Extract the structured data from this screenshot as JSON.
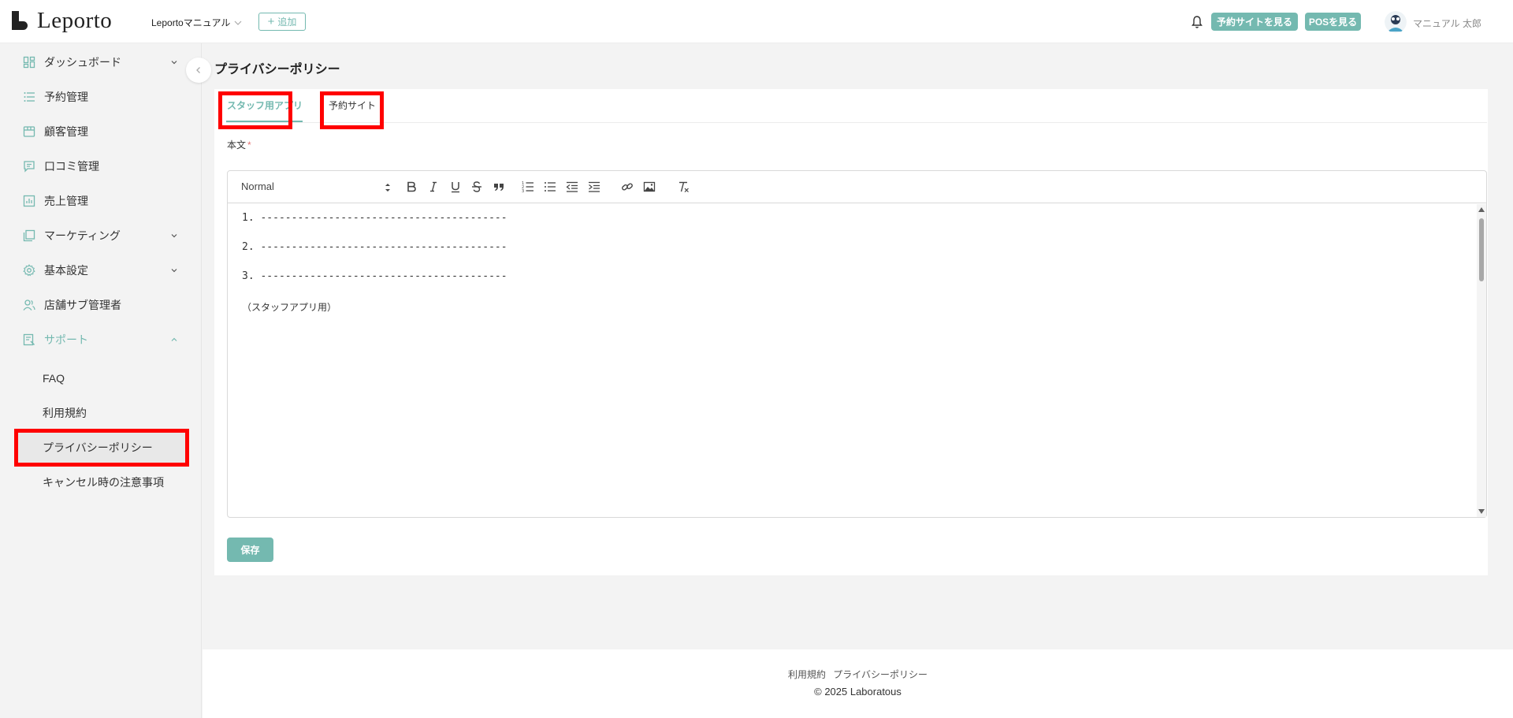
{
  "brand": {
    "name": "Leporto"
  },
  "header": {
    "store_name": "Leportoマニュアル",
    "add_label": "追加",
    "view_site_label": "予約サイトを見る",
    "view_pos_label": "POSを見る",
    "user_name": "マニュアル 太郎",
    "icons": [
      "bell-icon",
      "avatar"
    ]
  },
  "sidebar": {
    "items": [
      {
        "label": "ダッシュボード",
        "icon": "dashboard-icon",
        "expandable": true
      },
      {
        "label": "予約管理",
        "icon": "list-icon"
      },
      {
        "label": "顧客管理",
        "icon": "customer-card-icon"
      },
      {
        "label": "口コミ管理",
        "icon": "review-icon"
      },
      {
        "label": "売上管理",
        "icon": "sales-chart-icon"
      },
      {
        "label": "マーケティング",
        "icon": "marketing-icon",
        "expandable": true
      },
      {
        "label": "基本設定",
        "icon": "gear-icon",
        "expandable": true
      },
      {
        "label": "店舗サブ管理者",
        "icon": "users-icon"
      },
      {
        "label": "サポート",
        "icon": "support-icon",
        "expandable": true,
        "expanded": true,
        "active": true
      }
    ],
    "sub_items": [
      {
        "label": "FAQ"
      },
      {
        "label": "利用規約"
      },
      {
        "label": "プライバシーポリシー",
        "selected": true
      },
      {
        "label": "キャンセル時の注意事項"
      }
    ]
  },
  "main": {
    "title": "プライバシーポリシー",
    "tabs": [
      {
        "label": "スタッフ用アプリ",
        "active": true
      },
      {
        "label": "予約サイト",
        "active": false
      }
    ],
    "field_label": "本文",
    "required_mark": "*",
    "editor": {
      "format_select": "Normal",
      "toolbar_buttons": [
        "bold",
        "italic",
        "underline",
        "strike",
        "blockquote",
        "ordered-list",
        "bullet-list",
        "outdent",
        "indent",
        "link",
        "image",
        "clear-format"
      ],
      "lines": [
        "1. ----------------------------------------",
        "2. ----------------------------------------",
        "3. ----------------------------------------"
      ],
      "note": "（スタッフアプリ用）"
    },
    "save_label": "保存"
  },
  "footer": {
    "links": [
      "利用規約",
      "プライバシーポリシー"
    ],
    "copyright": "2025 Laboratous"
  },
  "colors": {
    "accent": "#74b9b0",
    "highlight": "#ff0000"
  }
}
